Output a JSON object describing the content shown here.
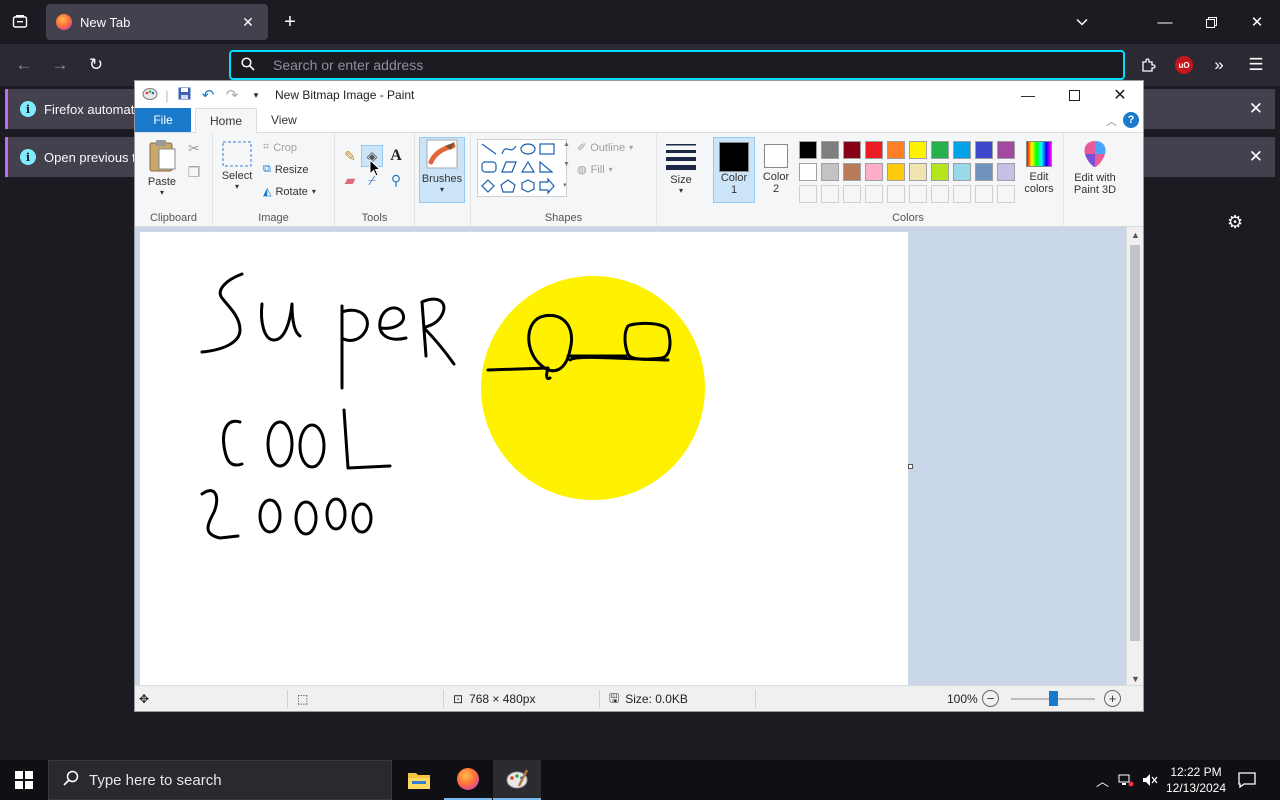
{
  "browser": {
    "tab_title": "New Tab",
    "url_placeholder": "Search or enter address",
    "notifications": [
      {
        "text": "Firefox automatic"
      },
      {
        "text": "Open previous tab"
      }
    ]
  },
  "paint": {
    "window_title": "New Bitmap Image - Paint",
    "menu_tabs": {
      "file": "File",
      "home": "Home",
      "view": "View"
    },
    "help_label": "?",
    "clipboard": {
      "paste": "Paste",
      "group": "Clipboard"
    },
    "image": {
      "select": "Select",
      "crop": "Crop",
      "resize": "Resize",
      "rotate": "Rotate",
      "group": "Image"
    },
    "tools": {
      "group": "Tools",
      "text_tool": "A"
    },
    "brushes": {
      "label": "Brushes"
    },
    "shapes": {
      "outline": "Outline",
      "fill": "Fill",
      "group": "Shapes"
    },
    "size": {
      "label": "Size"
    },
    "color1": {
      "label_a": "Color",
      "label_b": "1",
      "value": "#000000"
    },
    "color2": {
      "label_a": "Color",
      "label_b": "2",
      "value": "#ffffff"
    },
    "colors_group": "Colors",
    "edit_colors": {
      "line1": "Edit",
      "line2": "colors"
    },
    "edit_3d": {
      "line1": "Edit with",
      "line2": "Paint 3D"
    },
    "palette": [
      "#000000",
      "#7f7f7f",
      "#880015",
      "#ed1c24",
      "#ff7f27",
      "#fff200",
      "#22b14c",
      "#00a2e8",
      "#3f48cc",
      "#a349a4",
      "#ffffff",
      "#c3c3c3",
      "#b97a57",
      "#ffaec9",
      "#ffc90e",
      "#efe4b0",
      "#b5e61d",
      "#99d9ea",
      "#7092be",
      "#c8bfe7"
    ],
    "status": {
      "dimensions": "768 × 480px",
      "size": "Size: 0.0KB",
      "zoom": "100%",
      "zoom_fraction": 0.5
    },
    "drawing": {
      "sun_color": "#fff200",
      "ink_color": "#000000"
    }
  },
  "taskbar": {
    "search_placeholder": "Type here to search",
    "time": "12:22 PM",
    "date": "12/13/2024"
  }
}
